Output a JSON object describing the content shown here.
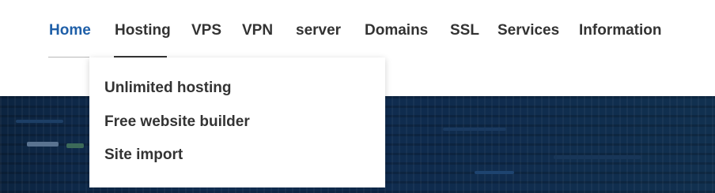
{
  "nav": {
    "items": [
      {
        "label": "Home",
        "active": true
      },
      {
        "label": "Hosting",
        "active": false
      },
      {
        "label": "VPS",
        "active": false
      },
      {
        "label": "VPN",
        "active": false
      },
      {
        "label": "server",
        "active": false
      },
      {
        "label": "Domains",
        "active": false
      },
      {
        "label": "SSL",
        "active": false
      },
      {
        "label": "Services",
        "active": false
      },
      {
        "label": "Information",
        "active": false
      }
    ]
  },
  "dropdown": {
    "parent": "Hosting",
    "items": [
      {
        "label": "Unlimited hosting"
      },
      {
        "label": "Free website builder"
      },
      {
        "label": "Site import"
      }
    ]
  },
  "colors": {
    "active_link": "#1f5fa8",
    "text": "#333333",
    "hero_background": "#0f2b4d"
  }
}
